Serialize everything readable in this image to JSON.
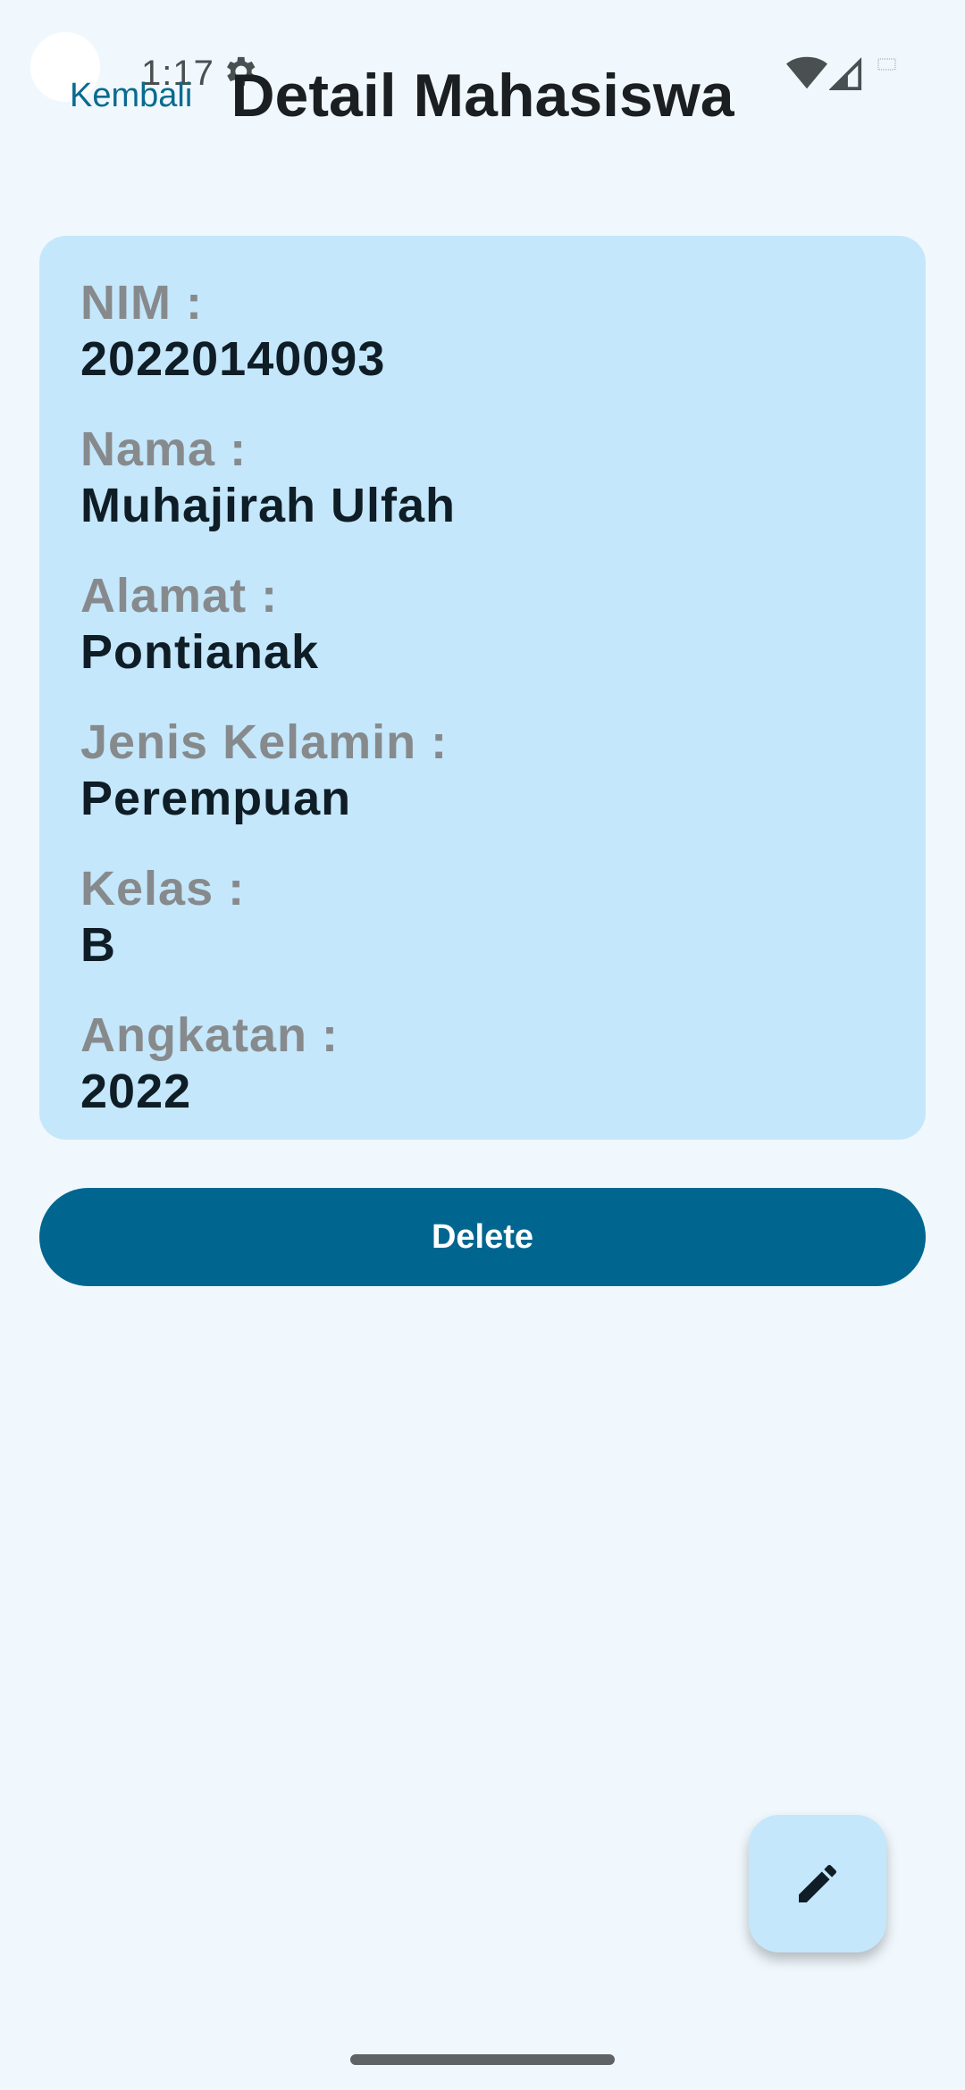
{
  "status_bar": {
    "time": "1:17",
    "icons": [
      "gear-icon",
      "wifi-icon",
      "cell-signal-icon",
      "battery-icon"
    ]
  },
  "app_bar": {
    "back_label": "Kembali",
    "title": "Detail Mahasiswa"
  },
  "detail": {
    "fields": [
      {
        "label": "NIM :",
        "value": "20220140093"
      },
      {
        "label": "Nama :",
        "value": "Muhajirah Ulfah"
      },
      {
        "label": "Alamat :",
        "value": "Pontianak"
      },
      {
        "label": "Jenis Kelamin :",
        "value": "Perempuan"
      },
      {
        "label": "Kelas :",
        "value": "B"
      },
      {
        "label": "Angkatan :",
        "value": "2022"
      }
    ]
  },
  "actions": {
    "delete_label": "Delete",
    "edit_icon": "pencil-icon"
  },
  "colors": {
    "background": "#f0f8fd",
    "card": "#c4e7fb",
    "primary": "#006690",
    "label": "#878a8c",
    "value": "#0f1d26"
  }
}
